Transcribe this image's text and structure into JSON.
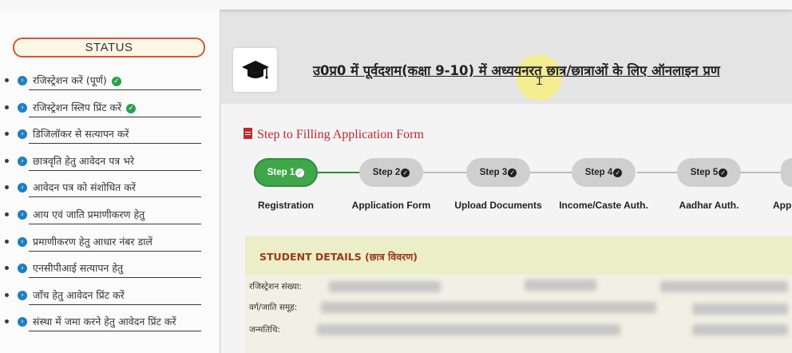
{
  "sidebar": {
    "status_label": "STATUS",
    "items": [
      {
        "label": "रजिस्ट्रेशन करें (पूर्ण)",
        "done": true
      },
      {
        "label": "रजिस्ट्रेशन स्लिप प्रिंट करें",
        "done": true
      },
      {
        "label": "डिजिलॉकर से सत्यापन करें",
        "done": false
      },
      {
        "label": "छात्रवृति हेतु आवेदन पत्र भरे",
        "done": false
      },
      {
        "label": "आवेदन पत्र को संशोधित करें",
        "done": false
      },
      {
        "label": "आय एवं जाति प्रमाणीकरण हेतु",
        "done": false
      },
      {
        "label": "प्रमाणीकरण हेतु आधार नंबर डालें",
        "done": false
      },
      {
        "label": "एनसीपीआई सत्यापन हेतु",
        "done": false
      },
      {
        "label": "जाँच हेतु आवेदन प्रिंट करें",
        "done": false
      },
      {
        "label": "संस्था में जमा करने हेतु आवेदन प्रिंट करें",
        "done": false
      }
    ]
  },
  "header": {
    "title": "उ0प्र0 में पूर्वदशम(कक्षा 9-10) में अध्ययनरत छात्र/छात्राओं के लिए ऑनलाइन प्रण"
  },
  "form": {
    "section_title": "Step to Filling Application Form",
    "steps": [
      {
        "pill": "Step 1",
        "label": "Registration",
        "active": true
      },
      {
        "pill": "Step 2",
        "label": "Application Form",
        "active": false
      },
      {
        "pill": "Step 3",
        "label": "Upload Documents",
        "active": false
      },
      {
        "pill": "Step 4",
        "label": "Income/Caste Auth.",
        "active": false
      },
      {
        "pill": "Step 5",
        "label": "Aadhar Auth.",
        "active": false
      },
      {
        "pill": "",
        "label": "App",
        "active": false
      }
    ]
  },
  "student_details": {
    "title": "STUDENT DETAILS (छात्र विवरण)",
    "fields": [
      {
        "label": "रजिस्ट्रेशन संख्या:"
      },
      {
        "label": "वर्ग/जाति समूह:"
      },
      {
        "label": "जन्मतिथि:"
      }
    ]
  },
  "colors": {
    "active_step": "#3fa64a",
    "inactive_step": "#cfcfcf",
    "heading_red": "#c1272d",
    "status_border": "#d9533a",
    "check_green": "#2aa14a",
    "bullet_blue": "#1f7fc2"
  },
  "icons": {
    "logo": "graduation-cap-icon",
    "section": "document-icon",
    "bullet": "arrow-circle-icon",
    "done": "check-circle-icon"
  }
}
